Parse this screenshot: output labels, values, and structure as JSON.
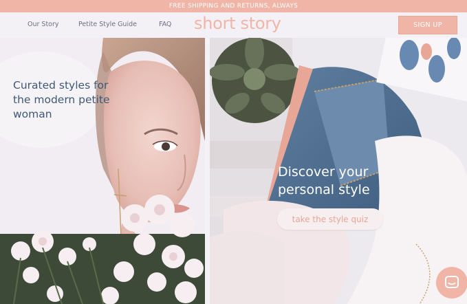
{
  "promo": {
    "text": "FREE SHIPPING AND RETURNS, ALWAYS"
  },
  "nav": {
    "items": [
      {
        "label": "Our Story"
      },
      {
        "label": "Petite Style Guide"
      },
      {
        "label": "FAQ"
      }
    ],
    "logo": "short story",
    "signup_label": "SIGN UP"
  },
  "hero": {
    "left_headline": "Curated styles for the modern petite woman",
    "right_headline": "Discover your personal style",
    "quiz_button_label": "take the style quiz"
  },
  "colors": {
    "accent": "#f0b5a6",
    "headline_navy": "#3f5875",
    "nav_text": "#6b6f80"
  },
  "icons": {
    "chat": "chat-icon"
  }
}
